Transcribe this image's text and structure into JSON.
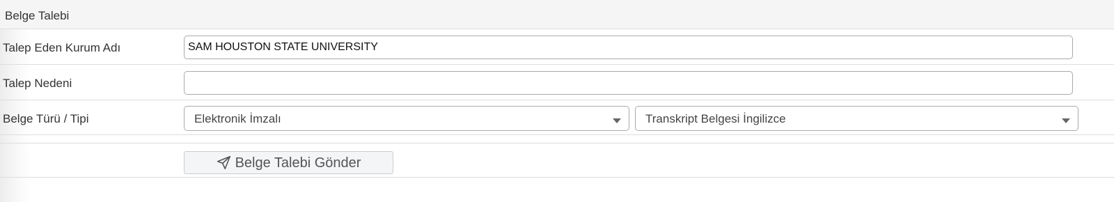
{
  "panel": {
    "title": "Belge Talebi"
  },
  "form": {
    "institution": {
      "label": "Talep Eden Kurum Adı",
      "value": "SAM HOUSTON STATE UNIVERSITY"
    },
    "reason": {
      "label": "Talep Nedeni",
      "value": ""
    },
    "document_type": {
      "label": "Belge Türü / Tipi",
      "signature_type": "Elektronik İmzalı",
      "document_kind": "Transkript Belgesi İngilizce"
    },
    "submit": {
      "label": "Belge Talebi Gönder",
      "icon": "paper-plane-icon"
    }
  }
}
